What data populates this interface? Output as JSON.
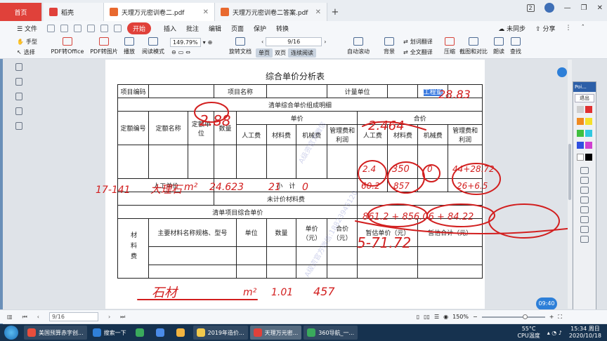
{
  "tabs": [
    {
      "label": "首页",
      "color": "#e0413a"
    },
    {
      "label": "稻壳",
      "color": "#e0413a"
    },
    {
      "label": "天理万元密训卷二.pdf",
      "color": "#e8692f"
    },
    {
      "label": "天理万元密训卷二答案.pdf",
      "color": "#e8692f"
    }
  ],
  "window": {
    "badge": "2"
  },
  "menu": {
    "file": "文件",
    "start": "开始",
    "items": [
      "插入",
      "批注",
      "编辑",
      "页面",
      "保护",
      "转换"
    ],
    "sync": "未同步",
    "share": "分享"
  },
  "ribbon": {
    "hand": "手型",
    "select": "选择",
    "pdf_to_office": "PDF转Office",
    "pdf_to_image": "PDF转图片",
    "play": "播放",
    "read_mode": "阅读模式",
    "zoom": "149.79%",
    "page": "9/16",
    "rotate": "旋转文档",
    "single": "单页",
    "double": "双页",
    "continuous": "连续阅读",
    "auto_scroll": "自动滚动",
    "background": "背景",
    "translate": "划词翻译",
    "full_translate": "全文翻译",
    "compress": "压缩",
    "screenshot": "截图和对比",
    "read_aloud": "朗读",
    "find": "查找"
  },
  "doc": {
    "title": "综合单价分析表",
    "row1": {
      "code": "项目编码",
      "name": "项目名称",
      "unit": "计量单位",
      "qty": "工程量"
    },
    "detail_header": "清单综合单价组成明细",
    "cols": {
      "quota_code": "定额编号",
      "quota_name": "定额名称",
      "quota_unit": "定额单位",
      "quantity": "数量",
      "unit_price": "单价",
      "total": "合价",
      "labor": "人工费",
      "material": "材料费",
      "machine": "机械费",
      "mgmt": "管理费和利润"
    },
    "labor_unit_price": "人工单价",
    "subtotal": "小　计",
    "unpriced_material": "未计价材料费",
    "unit_price_total": "清单项目综合单价",
    "material_label": "材料费",
    "mat_cols": {
      "name": "主要材料名称规格、型号",
      "unit": "单位",
      "qty": "数量",
      "price": "单价（元）",
      "total": "合价（元）",
      "est_price": "暂估单价（元）",
      "est_total": "暂估合计（元）"
    },
    "watermarks": [
      "A级资官方微信",
      "A级资官方微信:18823945120"
    ]
  },
  "handwriting": {
    "qty": "28.83",
    "b1": "2.88",
    "b2": "2.464",
    "quota": "17-141",
    "name": "大理石",
    "unit": "m²",
    "qty_row": "24.623",
    "labor": "21",
    "material": "0",
    "h_labor": "2.4",
    "h_mat": "350",
    "h_mach": "0",
    "h_mgmt": "44+28.72",
    "h_labor2": "60.2",
    "h_mat2": "857",
    "h_mgmt2": "26+6.5",
    "subtotal": "861.2 + 856.06 + 84.22",
    "unit_price_total": "5-71.72",
    "mat_name": "石材",
    "mat_unit": "m²",
    "mat_qty": "1.01",
    "mat_price": "457"
  },
  "pointofix": {
    "title": "Poi...",
    "exit": "退出"
  },
  "status": {
    "page": "9/16",
    "zoom": "150%"
  },
  "bubble": "09:40",
  "taskbar": {
    "items": [
      {
        "label": "美国预算赤字创...",
        "color": "#e94e3c"
      },
      {
        "label": "搜索一下",
        "color": "#2f7fd7"
      },
      {
        "label": "",
        "color": "#3aaa5c"
      },
      {
        "label": "",
        "color": "#4a8be8"
      },
      {
        "label": "",
        "color": "#f2b440"
      },
      {
        "label": "2019年造价...",
        "color": "#f2c94c"
      },
      {
        "label": "天理万元密...",
        "color": "#e0413a"
      },
      {
        "label": "360导航_一...",
        "color": "#3aaa5c"
      }
    ],
    "temp": "55°C",
    "cpu": "CPU温度",
    "time": "15:34 周日",
    "date": "2020/10/18"
  }
}
